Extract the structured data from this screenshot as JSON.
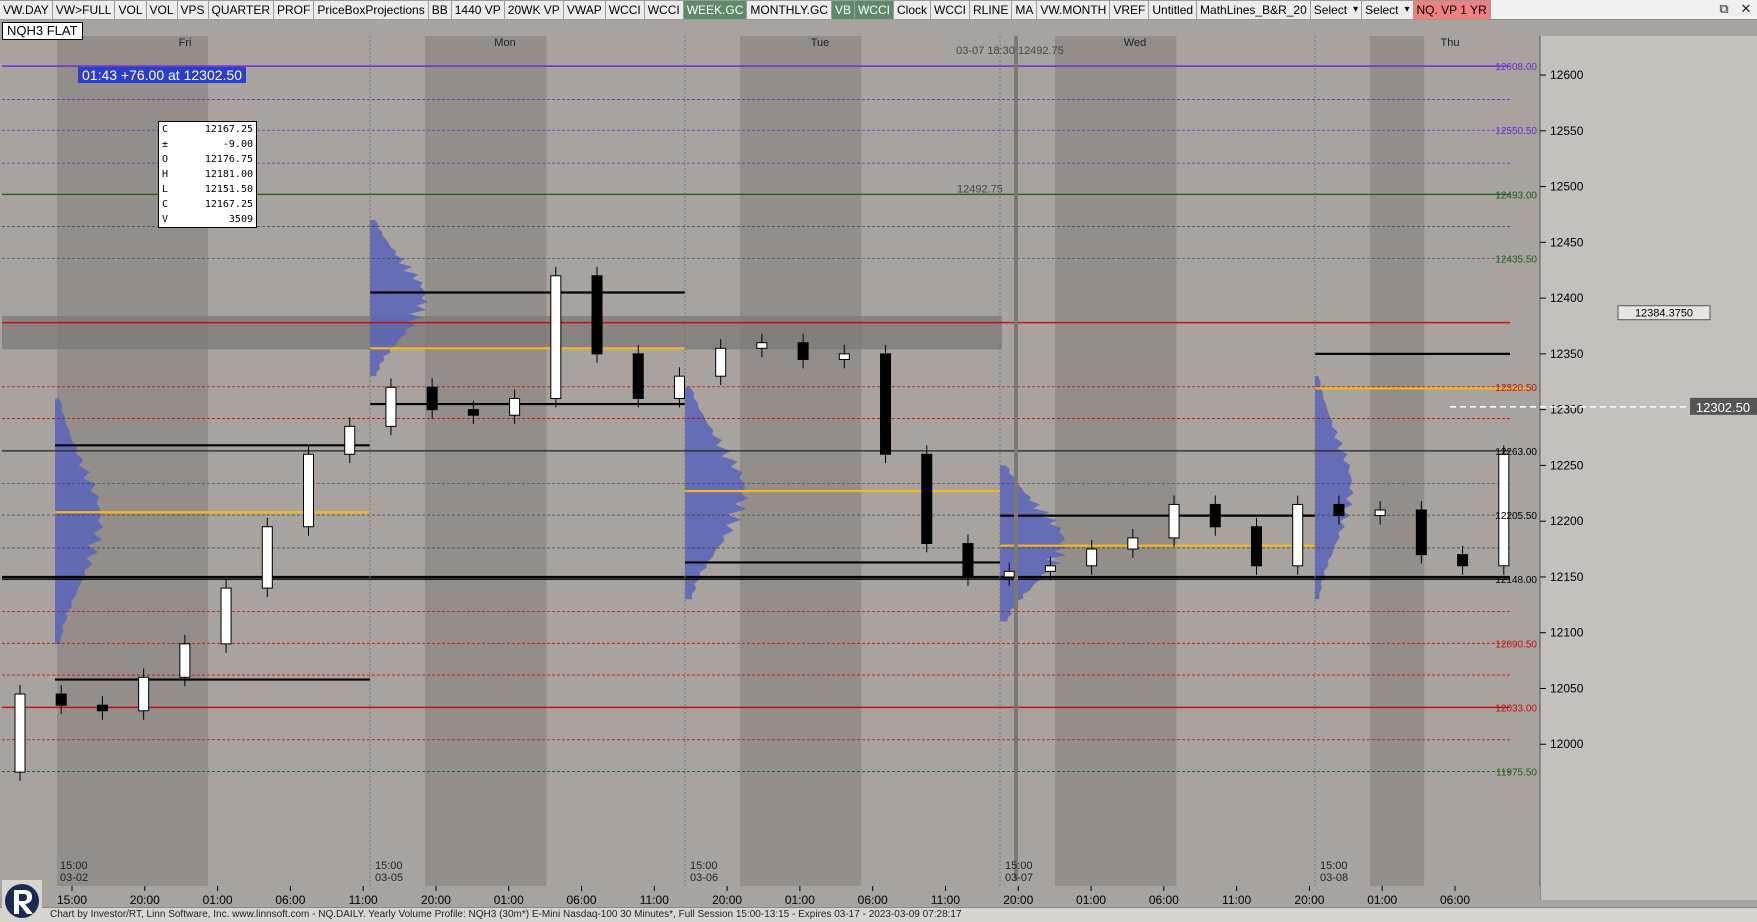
{
  "toolbar": {
    "buttons": [
      {
        "label": "VW.DAY",
        "state": "normal"
      },
      {
        "label": "VW>FULL",
        "state": "normal"
      },
      {
        "label": "VOL",
        "state": "normal"
      },
      {
        "label": "VOL",
        "state": "normal"
      },
      {
        "label": "VPS",
        "state": "normal"
      },
      {
        "label": "QUARTER",
        "state": "normal"
      },
      {
        "label": "PROF",
        "state": "normal"
      },
      {
        "label": "PriceBoxProjections",
        "state": "normal"
      },
      {
        "label": "BB",
        "state": "normal"
      },
      {
        "label": "1440 VP",
        "state": "normal"
      },
      {
        "label": "20WK VP",
        "state": "normal"
      },
      {
        "label": "VWAP",
        "state": "normal"
      },
      {
        "label": "WCCI",
        "state": "normal"
      },
      {
        "label": "WCCI",
        "state": "normal"
      },
      {
        "label": "WEEK.GC",
        "state": "active"
      },
      {
        "label": "MONTHLY.GC",
        "state": "normal"
      },
      {
        "label": "VB",
        "state": "active"
      },
      {
        "label": "WCCI",
        "state": "active"
      },
      {
        "label": "Clock",
        "state": "normal"
      },
      {
        "label": "WCCI",
        "state": "normal"
      },
      {
        "label": "RLINE",
        "state": "normal"
      },
      {
        "label": "MA",
        "state": "normal"
      },
      {
        "label": "VW.MONTH",
        "state": "normal"
      },
      {
        "label": "VREF",
        "state": "normal"
      },
      {
        "label": "Untitled",
        "state": "normal"
      },
      {
        "label": "MathLines_B&R_20",
        "state": "normal"
      },
      {
        "label": "Select",
        "state": "select"
      },
      {
        "label": "Select",
        "state": "select"
      },
      {
        "label": "NQ. VP 1 YR",
        "state": "red"
      }
    ],
    "window_controls": [
      "restore-icon",
      "close-icon"
    ]
  },
  "chart": {
    "title": "NQH3 FLAT",
    "change_badge": "01:43  +76.00 at 12302.50",
    "ohlc": [
      {
        "k": "C",
        "v": "12167.25"
      },
      {
        "k": "±",
        "v": "-9.00"
      },
      {
        "k": "O",
        "v": "12176.75"
      },
      {
        "k": "H",
        "v": "12181.00"
      },
      {
        "k": "L",
        "v": "12151.50"
      },
      {
        "k": "C",
        "v": "12167.25"
      },
      {
        "k": "V",
        "v": "3509"
      }
    ],
    "day_labels": [
      "Fri",
      "Mon",
      "Tue",
      "Wed",
      "Thu"
    ],
    "session_labels": [
      {
        "time": "15:00",
        "date": "03-02"
      },
      {
        "time": "15:00",
        "date": "03-05"
      },
      {
        "time": "15:00",
        "date": "03-06"
      },
      {
        "time": "15:00",
        "date": "03-07"
      },
      {
        "time": "15:00",
        "date": "03-08"
      }
    ],
    "time_axis_labels": [
      "15:00",
      "20:00",
      "01:00",
      "06:00",
      "11:00",
      "20:00",
      "01:00",
      "06:00",
      "11:00",
      "20:00",
      "01:00",
      "06:00",
      "11:00",
      "20:00",
      "01:00",
      "06:00",
      "11:00",
      "20:00",
      "01:00",
      "06:00"
    ],
    "price_axis_ticks": [
      "12600",
      "12550",
      "12500",
      "12450",
      "12400",
      "12350",
      "12300",
      "12250",
      "12200",
      "12150",
      "12100",
      "12050",
      "12000"
    ],
    "level_labels": [
      {
        "text": "12608.00",
        "color": "#6a2bd8"
      },
      {
        "text": "12550.50",
        "color": "#6a2bd8"
      },
      {
        "text": "12493.00",
        "color": "#1e5a1e"
      },
      {
        "text": "12435.50",
        "color": "#1e5a1e"
      },
      {
        "text": "12320.50",
        "color": "#c01010"
      },
      {
        "text": "12263.00",
        "color": "#000000"
      },
      {
        "text": "12205.50",
        "color": "#000000"
      },
      {
        "text": "12148.00",
        "color": "#000000"
      },
      {
        "text": "12090.50",
        "color": "#c01010"
      },
      {
        "text": "12033.00",
        "color": "#c01010"
      },
      {
        "text": "11975.50",
        "color": "#1e5a1e"
      }
    ],
    "cursor_price": "12384.3750",
    "last_price": "12302.50",
    "annotations": [
      "03-07 18:30  12492.75",
      "12492.75"
    ],
    "colors": {
      "bg": "#a8a39e",
      "session_shade": "#8c8783",
      "profile": "#5864b8",
      "poc": "#f5b820",
      "purple": "#6a2bd8",
      "red": "#c01010",
      "green": "#1e5a1e"
    }
  },
  "footer": {
    "text": "Chart by Investor/RT, Linn Software, Inc. www.linnsoft.com - NQ.DAILY. Yearly Volume Profile: NQH3 (30m*) E-Mini Nasdaq-100 30 Minutes*, Full Session 15:00-13:15 - Expires 03-17 - 2023-03-09 07:28:17"
  },
  "chart_data": {
    "type": "candlestick",
    "title": "NQH3 FLAT",
    "ylim": [
      11950,
      12635
    ],
    "x": [
      "Fri 15:00",
      "Fri 18:00",
      "Fri 21:00",
      "Sat 00:00",
      "Sat 03:00",
      "Sat 06:00",
      "Sat 09:00",
      "Sat 12:00",
      "Mon 15:00",
      "Mon 18:00",
      "Mon 21:00",
      "Tue 00:00",
      "Tue 03:00",
      "Tue 06:00",
      "Tue 09:00",
      "Tue 12:00",
      "Tue 15:00",
      "Tue 18:00",
      "Tue 21:00",
      "Wed 00:00",
      "Wed 03:00",
      "Wed 06:00",
      "Wed 09:00",
      "Wed 12:00",
      "Wed 15:00",
      "Wed 18:00",
      "Wed 21:00",
      "Thu 00:00",
      "Thu 03:00",
      "Thu 06:00",
      "Thu 09:00",
      "Thu 12:00",
      "Thu 15:00",
      "Thu 18:00",
      "Thu 21:00",
      "Fri 00:00",
      "Fri 03:00",
      "Fri 06:00"
    ],
    "close": [
      12045,
      12035,
      12030,
      12060,
      12090,
      12140,
      12195,
      12260,
      12285,
      12320,
      12300,
      12295,
      12310,
      12420,
      12350,
      12310,
      12330,
      12355,
      12360,
      12345,
      12350,
      12260,
      12180,
      12150,
      12155,
      12160,
      12175,
      12185,
      12215,
      12195,
      12160,
      12215,
      12205,
      12210,
      12170,
      12160,
      12260,
      12302.5
    ],
    "open": [
      11975,
      12045,
      12035,
      12030,
      12060,
      12090,
      12140,
      12195,
      12260,
      12285,
      12320,
      12300,
      12295,
      12310,
      12420,
      12350,
      12310,
      12330,
      12355,
      12360,
      12345,
      12350,
      12260,
      12180,
      12150,
      12155,
      12160,
      12175,
      12185,
      12215,
      12195,
      12160,
      12215,
      12205,
      12210,
      12170,
      12160,
      12330
    ],
    "levels": [
      12608,
      12550.5,
      12493,
      12435.5,
      12320.5,
      12263,
      12205.5,
      12148,
      12090.5,
      12033,
      11975.5
    ]
  }
}
